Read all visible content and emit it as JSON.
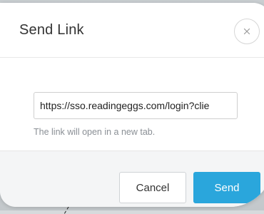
{
  "dialog": {
    "title": "Send Link",
    "close_icon": "close-icon",
    "link_value": "https://sso.readingeggs.com/login?clie",
    "help_text": "The link will open in a new tab.",
    "cancel_label": "Cancel",
    "send_label": "Send"
  },
  "colors": {
    "accent": "#2aa6dc",
    "backdrop": "#d7dadc"
  }
}
